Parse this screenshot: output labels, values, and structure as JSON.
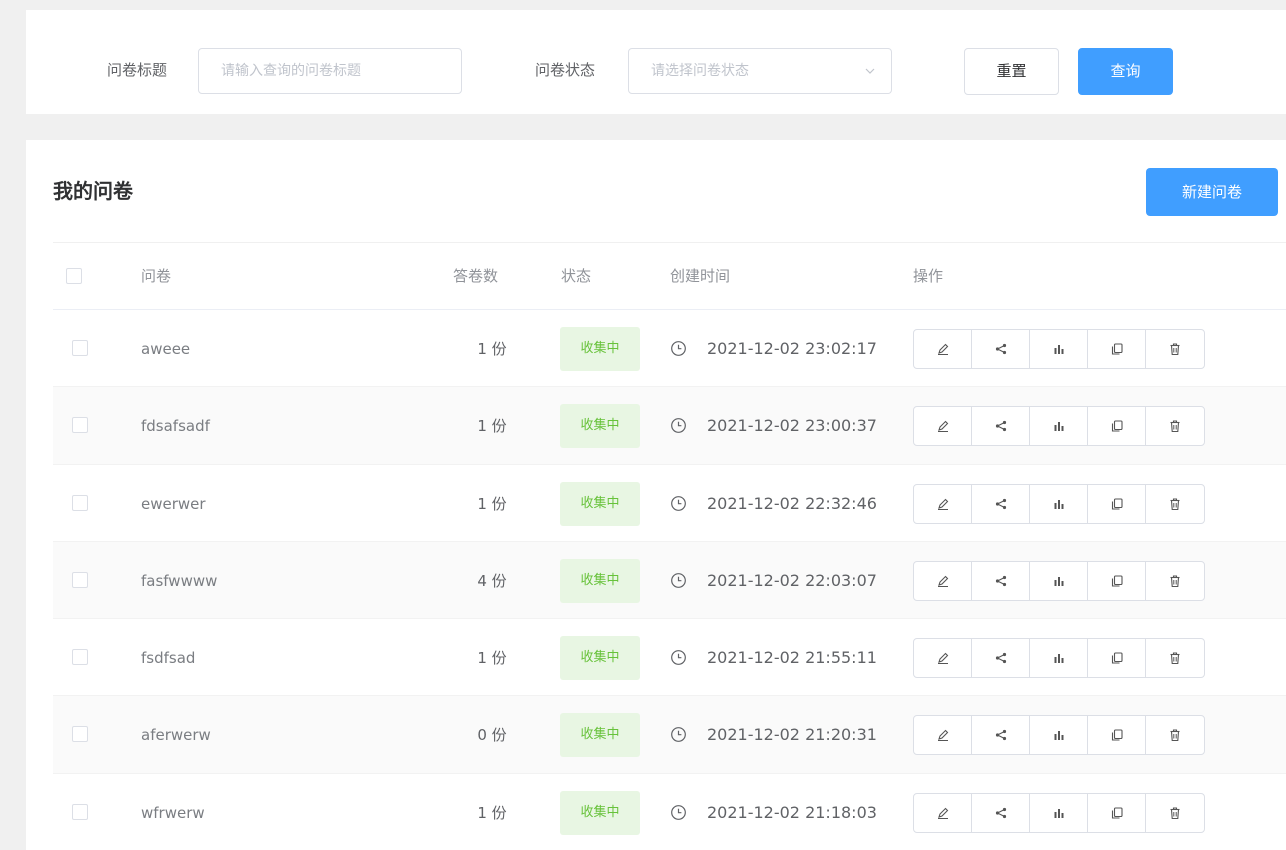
{
  "filter": {
    "title_label": "问卷标题",
    "title_placeholder": "请输入查询的问卷标题",
    "status_label": "问卷状态",
    "status_placeholder": "请选择问卷状态",
    "reset_label": "重置",
    "query_label": "查询"
  },
  "page": {
    "title": "我的问卷",
    "new_button": "新建问卷"
  },
  "table": {
    "headers": {
      "title": "问卷",
      "count": "答卷数",
      "status": "状态",
      "created": "创建时间",
      "actions": "操作"
    },
    "rows": [
      {
        "title": "aweee",
        "count": "1 份",
        "status": "收集中",
        "created": "2021-12-02 23:02:17"
      },
      {
        "title": "fdsafsadf",
        "count": "1 份",
        "status": "收集中",
        "created": "2021-12-02 23:00:37"
      },
      {
        "title": "ewerwer",
        "count": "1 份",
        "status": "收集中",
        "created": "2021-12-02 22:32:46"
      },
      {
        "title": "fasfwwww",
        "count": "4 份",
        "status": "收集中",
        "created": "2021-12-02 22:03:07"
      },
      {
        "title": "fsdfsad",
        "count": "1 份",
        "status": "收集中",
        "created": "2021-12-02 21:55:11"
      },
      {
        "title": "aferwerw",
        "count": "0 份",
        "status": "收集中",
        "created": "2021-12-02 21:20:31"
      },
      {
        "title": "wfrwerw",
        "count": "1 份",
        "status": "收集中",
        "created": "2021-12-02 21:18:03"
      }
    ],
    "action_icons": [
      "edit-icon",
      "share-icon",
      "chart-icon",
      "copy-icon",
      "delete-icon"
    ]
  },
  "colors": {
    "primary": "#409eff",
    "status_bg": "#e8f6e3",
    "status_text": "#67c23a"
  }
}
